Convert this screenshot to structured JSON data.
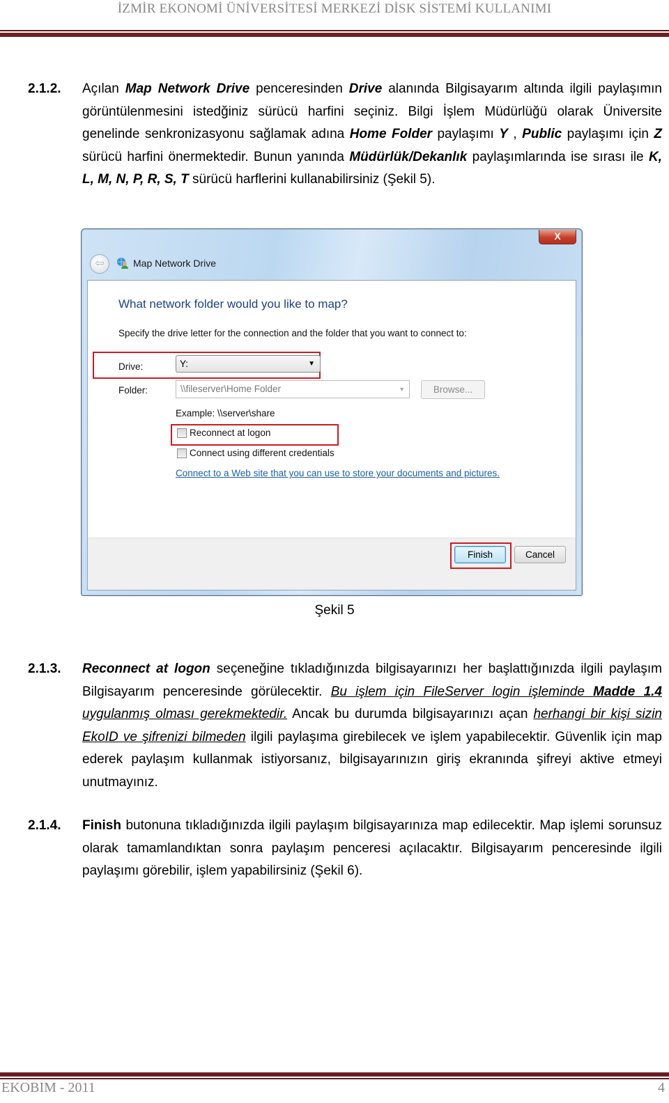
{
  "header": {
    "title": "İZMİR EKONOMİ ÜNİVERSİTESİ MERKEZİ DİSK SİSTEMİ KULLANIMI"
  },
  "sections": {
    "s212": {
      "number": "2.1.2.",
      "parts": [
        "Açılan ",
        "Map Network Drive",
        " penceresinden ",
        "Drive",
        " alanında Bilgisayarım altında ilgili paylaşımın görüntülenmesini istedğiniz sürücü harfini seçiniz. Bilgi İşlem Müdürlüğü olarak Üniversite genelinde senkronizasyonu sağlamak adına ",
        "Home Folder",
        " paylaşımı ",
        "Y",
        " , ",
        "Public",
        " paylaşımı için ",
        "Z",
        " sürücü harfini önermektedir. Bunun yanında ",
        "Müdürlük/Dekanlık",
        " paylaşımlarında ise sırası ile ",
        "K, L, M, N, P, R, S, T",
        " sürücü harflerini kullanabilirsiniz (Şekil 5)."
      ]
    },
    "s213": {
      "number": "2.1.3.",
      "parts": [
        "Reconnect at logon",
        " seçeneğine tıkladığınızda bilgisayarınızı her başlattığınızda ilgili paylaşım Bilgisayarım penceresinde görülecektir. ",
        "Bu işlem için FileServer login işleminde ",
        "Madde 1.4",
        " uygulanmış olması gerekmektedir.",
        " Ancak bu durumda bilgisayarınızı açan ",
        "herhangi bir kişi sizin EkoID ve şifrenizi bilmeden",
        " ilgili paylaşıma girebilecek ve işlem yapabilecektir. Güvenlik için map ederek paylaşım kullanmak istiyorsanız, bilgisayarınızın giriş ekranında şifreyi aktive etmeyi unutmayınız."
      ]
    },
    "s214": {
      "number": "2.1.4.",
      "parts": [
        "Finish",
        " butonuna tıkladığınızda ilgili paylaşım bilgisayarınıza map edilecektir. Map işlemi sorunsuz olarak tamamlandıktan sonra paylaşım penceresi açılacaktır. Bilgisayarım penceresinde ilgili paylaşımı görebilir, işlem yapabilirsiniz (Şekil 6)."
      ]
    }
  },
  "dialog": {
    "close_label": "X",
    "window_title": "Map Network Drive",
    "heading": "What network folder would you like to map?",
    "instruction": "Specify the drive letter for the connection and the folder that you want to connect to:",
    "drive_label": "Drive:",
    "drive_value": "Y:",
    "folder_label": "Folder:",
    "folder_value": "\\\\fileserver\\Home Folder",
    "browse_label": "Browse...",
    "example": "Example: \\\\server\\share",
    "reconnect_label": "Reconnect at logon",
    "reconnect_checked": false,
    "credentials_label": "Connect using different credentials",
    "credentials_checked": false,
    "web_link": "Connect to a Web site that you can use to store your documents and pictures.",
    "finish_label": "Finish",
    "cancel_label": "Cancel",
    "highlight_color": "#cc1a24"
  },
  "caption": "Şekil 5",
  "footer": {
    "left": "EKOBIM - 2011",
    "page_number": "4"
  }
}
